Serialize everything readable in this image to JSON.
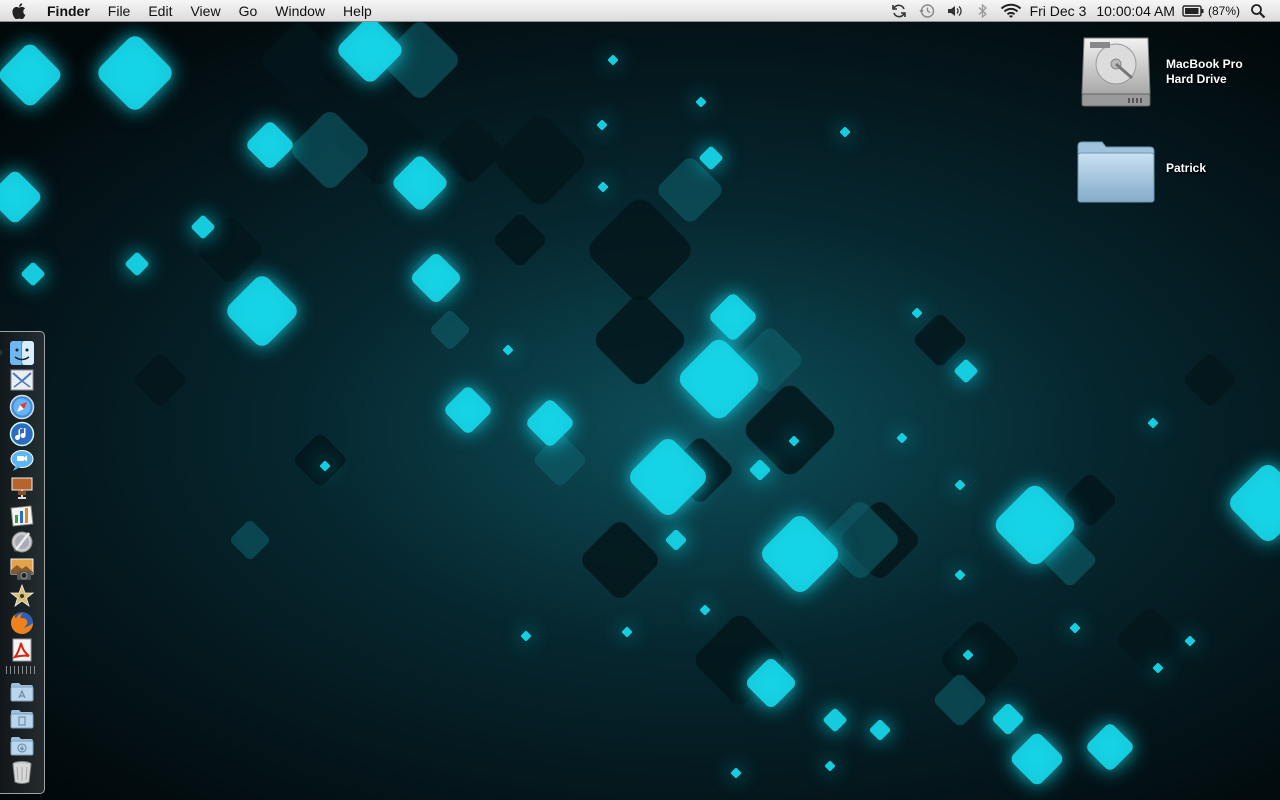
{
  "menubar": {
    "app_name": "Finder",
    "menus": [
      "File",
      "Edit",
      "View",
      "Go",
      "Window",
      "Help"
    ],
    "clock_date": "Fri Dec 3",
    "clock_time": "10:00:04 AM",
    "battery_percent": "(87%)",
    "status_icons": [
      "sync-icon",
      "time-machine-icon",
      "volume-icon",
      "bluetooth-icon",
      "wifi-icon",
      "battery-icon",
      "spotlight-icon"
    ]
  },
  "desktop": {
    "icons": [
      {
        "name": "hard-drive-icon",
        "label_line1": "MacBook Pro",
        "label_line2": "Hard Drive"
      },
      {
        "name": "home-folder-icon",
        "label_line1": "Patrick",
        "label_line2": ""
      }
    ]
  },
  "dock": {
    "apps": [
      "finder-icon",
      "mail-icon",
      "safari-icon",
      "itunes-icon",
      "ichat-icon",
      "keynote-icon",
      "numbers-icon",
      "preview-icon",
      "iphoto-icon",
      "imovie-icon",
      "firefox-icon",
      "acrobat-icon"
    ],
    "stacks": [
      "applications-folder-icon",
      "documents-folder-icon",
      "downloads-folder-icon",
      "trash-icon"
    ]
  },
  "colors": {
    "accent_cyan": "#19d6e8",
    "background_dark": "#02090c"
  }
}
